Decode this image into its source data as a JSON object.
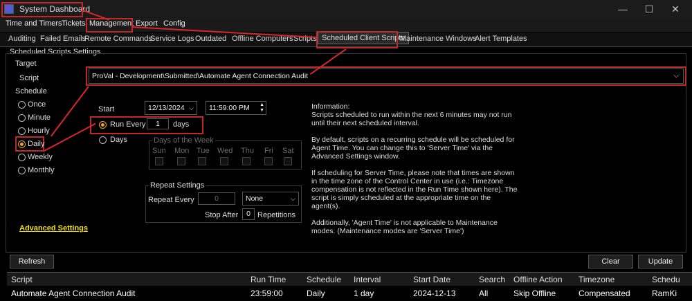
{
  "window": {
    "title": "System Dashboard",
    "min": "—",
    "max": "☐",
    "close": "✕"
  },
  "menu": [
    "Time and Timers",
    "Tickets",
    "Management",
    "Export",
    "Config"
  ],
  "tabs": [
    "Auditing",
    "Failed Emails",
    "Remote Commands",
    "Service Logs",
    "Outdated",
    "Offline Computers",
    "Scripts",
    "Scheduled Client Scripts",
    "Maintenance Windows",
    "Alert Templates"
  ],
  "panel_title": "Scheduled Scripts Settings",
  "target": {
    "label": "Target",
    "script_label": "Script",
    "script_value": "ProVal - Development\\Submitted\\Automate Agent Connection Audit"
  },
  "schedule": {
    "label": "Schedule",
    "options": [
      "Once",
      "Minute",
      "Hourly",
      "Daily",
      "Weekly",
      "Monthly"
    ],
    "selected": "Daily",
    "start_label": "Start",
    "start_date": "12/13/2024",
    "start_time": "11:59:00 PM",
    "run_every_label": "Run Every",
    "run_every_value": "1",
    "run_every_unit": "days",
    "days_label": "Days",
    "dow_label": "Days of the Week",
    "dow": [
      "Sun",
      "Mon",
      "Tue",
      "Wed",
      "Thu",
      "Fri",
      "Sat"
    ]
  },
  "repeat": {
    "label": "Repeat Settings",
    "every_label": "Repeat Every",
    "every_value": "0",
    "unit": "None",
    "stop_after_label": "Stop After",
    "stop_after_value": "0",
    "repetitions_label": "Repetitions"
  },
  "info": {
    "title": "Information:",
    "p1": "Scripts scheduled to run within the next 6 minutes may not run until their next scheduled interval.",
    "p2": "By default, scripts on a recurring schedule will be scheduled for Agent Time. You can change this to 'Server Time' via the Advanced Settings window.",
    "p3": "If scheduling for Server Time, please note that times are shown in the time zone of the Control Center in use (i.e.: Timezone compensation is not reflected in the Run Time shown here). The script is simply scheduled at the appropriate time on the agent(s).",
    "p4": "Additionally, 'Agent Time' is not applicable to Maintenance modes. (Maintenance modes are 'Server Time')"
  },
  "advanced_link": "Advanced Settings",
  "buttons": {
    "refresh": "Refresh",
    "clear": "Clear",
    "update": "Update"
  },
  "grid": {
    "headers": [
      "Script",
      "Run Time",
      "Schedule",
      "Interval",
      "Start Date",
      "Search",
      "Offline Action",
      "Timezone",
      "Schedu"
    ],
    "rows": [
      [
        "Automate Agent Connection Audit",
        "23:59:00",
        "Daily",
        "1 day",
        "2024-12-13",
        "All",
        "Skip Offline",
        "Compensated",
        "RamKi"
      ]
    ]
  },
  "colors": {
    "accent_radio": "#f0a030",
    "annotation_red": "#c0282a",
    "link_yellow": "#f2e200"
  }
}
